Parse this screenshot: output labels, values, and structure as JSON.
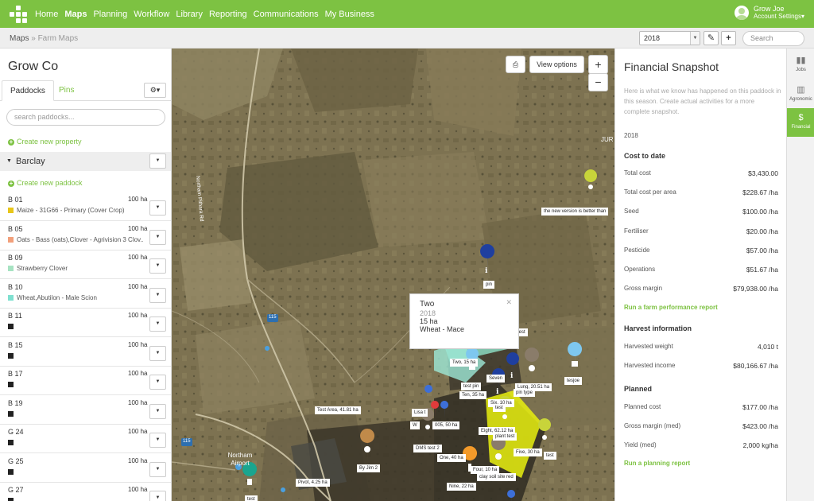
{
  "nav": {
    "items": [
      {
        "label": "Home",
        "active": false
      },
      {
        "label": "Maps",
        "active": true
      },
      {
        "label": "Planning",
        "active": false
      },
      {
        "label": "Workflow",
        "active": false
      },
      {
        "label": "Library",
        "active": false
      },
      {
        "label": "Reporting",
        "active": false
      },
      {
        "label": "Communications",
        "active": false
      },
      {
        "label": "My Business",
        "active": false
      }
    ],
    "account": {
      "name": "Grow Joe",
      "sub": "Account Settings▾"
    }
  },
  "breadcrumb": {
    "root": "Maps",
    "sep": "»",
    "current": "Farm Maps"
  },
  "toolbar": {
    "year": "2018",
    "search_placeholder": "Search"
  },
  "left": {
    "company": "Grow Co",
    "tabs": {
      "paddocks": "Paddocks",
      "pins": "Pins"
    },
    "search_placeholder": "search paddocks...",
    "create_property": "Create new property",
    "group": "Barclay",
    "create_paddock": "Create new paddock",
    "paddocks": [
      {
        "name": "B 01",
        "area": "100 ha",
        "crop": "Maize - 31G66 - Primary (Cover Crop)",
        "color": "#e8c619"
      },
      {
        "name": "B 05",
        "area": "100 ha",
        "crop": "Oats - Bass (oats),Clover - Agrivision 3 Clov...",
        "color": "#f2a07b"
      },
      {
        "name": "B 09",
        "area": "100 ha",
        "crop": "Strawberry Clover",
        "color": "#a7e3c2"
      },
      {
        "name": "B 10",
        "area": "100 ha",
        "crop": "Wheat,Abutilon - Male Scion",
        "color": "#7fe0d0"
      },
      {
        "name": "B 11",
        "area": "100 ha",
        "crop": "",
        "color": "#222222"
      },
      {
        "name": "B 15",
        "area": "100 ha",
        "crop": "",
        "color": "#222222"
      },
      {
        "name": "B 17",
        "area": "100 ha",
        "crop": "",
        "color": "#222222"
      },
      {
        "name": "B 19",
        "area": "100 ha",
        "crop": "",
        "color": "#222222"
      },
      {
        "name": "G 24",
        "area": "100 ha",
        "crop": "",
        "color": "#222222"
      },
      {
        "name": "G 25",
        "area": "100 ha",
        "crop": "",
        "color": "#222222"
      },
      {
        "name": "G 27",
        "area": "100 ha",
        "crop": "",
        "color": "#222222"
      }
    ]
  },
  "map": {
    "view_options": "View options",
    "zoom_in": "+",
    "zoom_out": "−",
    "road_labels": [
      "Northam Pithara Rd",
      "JUR",
      "115",
      "115",
      "Northam Airport"
    ],
    "tags": [
      "the new version is better than",
      "pin",
      "test",
      "Two, 15 ha",
      "test pin",
      "Seven",
      "Lung, 20.51 ha",
      "Ten, 35 ha",
      "pin type",
      "Six, 10 ha",
      "test",
      "tesjoe",
      "Test Area, 41.81 ha",
      "Lisa t",
      "W",
      "005, 50 ha",
      "Eight, 62.12 ha",
      "plant test",
      "DMS test 2",
      "Five, 30 ha",
      "test",
      "One, 40 ha",
      "By Jim 2",
      "Four, 10 ha",
      "clay soil site red",
      "Nine, 22 ha",
      "Pivot, 4.25 ha",
      "test"
    ],
    "popup": {
      "title": "Two",
      "year": "2018",
      "area": "15 ha",
      "crop": "Wheat - Mace"
    }
  },
  "snapshot": {
    "title": "Financial Snapshot",
    "desc": "Here is what we know has happened on this paddock in this season. Create actual activities for a more complete snapshot.",
    "year": "2018",
    "cost_heading": "Cost to date",
    "costs": [
      {
        "label": "Total cost",
        "value": "$3,430.00"
      },
      {
        "label": "Total cost per area",
        "value": "$228.67 /ha"
      },
      {
        "label": "Seed",
        "value": "$100.00 /ha"
      },
      {
        "label": "Fertiliser",
        "value": "$20.00 /ha"
      },
      {
        "label": "Pesticide",
        "value": "$57.00 /ha"
      },
      {
        "label": "Operations",
        "value": "$51.67 /ha"
      },
      {
        "label": "Gross margin",
        "value": "$79,938.00 /ha"
      }
    ],
    "farm_report": "Run a farm performance report",
    "harvest_heading": "Harvest information",
    "harvest": [
      {
        "label": "Harvested weight",
        "value": "4,010 t"
      },
      {
        "label": "Harvested income",
        "value": "$80,166.67 /ha"
      }
    ],
    "planned_heading": "Planned",
    "planned": [
      {
        "label": "Planned cost",
        "value": "$177.00 /ha"
      },
      {
        "label": "Gross margin (med)",
        "value": "$423.00 /ha"
      },
      {
        "label": "Yield (med)",
        "value": "2,000 kg/ha"
      }
    ],
    "planning_report": "Run a planning report"
  },
  "rail": [
    {
      "label": "Jobs",
      "icon": "jobs-icon",
      "active": false
    },
    {
      "label": "Agronomic",
      "icon": "bar-chart-icon",
      "active": false
    },
    {
      "label": "Financial",
      "icon": "dollar-icon",
      "active": true
    }
  ]
}
